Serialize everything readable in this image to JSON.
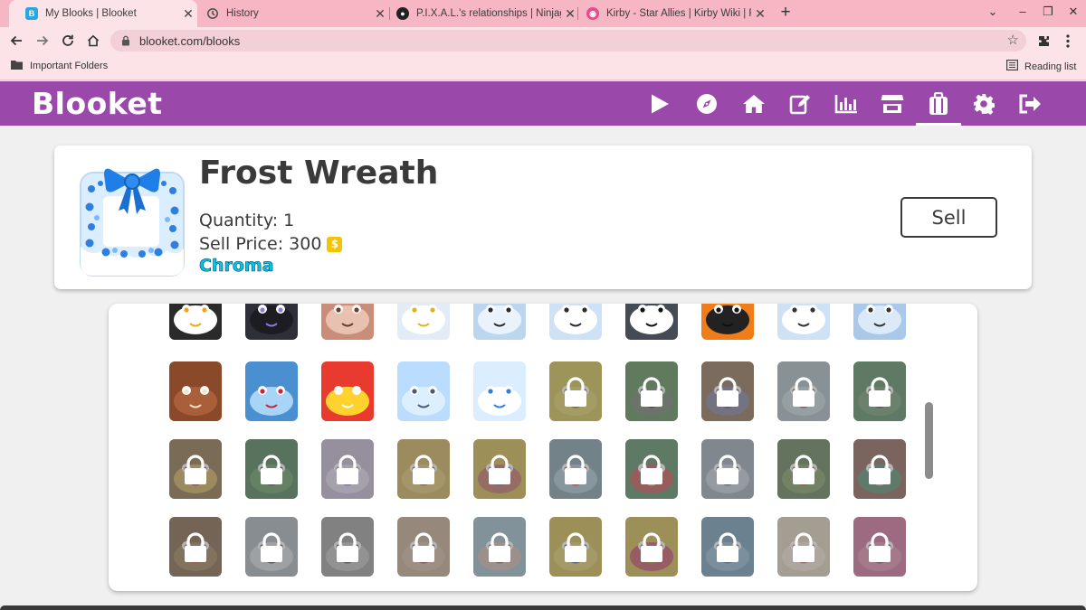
{
  "browser": {
    "tabs": [
      {
        "title": "My Blooks | Blooket",
        "favicon": "blooket-favicon",
        "active": true
      },
      {
        "title": "History",
        "favicon": "history-icon",
        "active": false
      },
      {
        "title": "P.I.X.A.L.'s relationships | Ninjago",
        "favicon": "fandom-favicon",
        "active": false
      },
      {
        "title": "Kirby - Star Allies | Kirby Wiki | Fa",
        "favicon": "kirby-favicon",
        "active": false
      }
    ],
    "url": "blooket.com/blooks",
    "bookmarks": {
      "folder": "Important Folders",
      "reading_list": "Reading list"
    }
  },
  "app": {
    "logo": "Blooket",
    "nav_icons": [
      "play-icon",
      "discover-icon",
      "home-icon",
      "create-icon",
      "stats-icon",
      "market-icon",
      "blooks-icon",
      "settings-icon",
      "logout-icon"
    ],
    "accent": "#9a49aa"
  },
  "selected_blook": {
    "name": "Frost Wreath",
    "quantity_label": "Quantity: 1",
    "sell_price_label": "Sell Price: 300",
    "coin_symbol": "$",
    "rarity": "Chroma",
    "rarity_color": "#00c6f2",
    "sell_button": "Sell"
  },
  "inventory": {
    "rows": [
      [
        {
          "blook": "toucan",
          "locked": false
        },
        {
          "blook": "panther",
          "locked": false
        },
        {
          "blook": "baboon",
          "locked": false
        },
        {
          "blook": "snowy-owl",
          "locked": false
        },
        {
          "blook": "polar-bear",
          "locked": false
        },
        {
          "blook": "arctic-fox",
          "locked": false
        },
        {
          "blook": "penguin",
          "locked": false
        },
        {
          "blook": "rockhopper",
          "locked": false
        },
        {
          "blook": "arctic-hare",
          "locked": false
        },
        {
          "blook": "seal",
          "locked": false
        }
      ],
      [
        {
          "blook": "walrus",
          "locked": false
        },
        {
          "blook": "shark",
          "locked": false
        },
        {
          "blook": "santa-claus",
          "locked": false
        },
        {
          "blook": "snow-globe",
          "locked": false
        },
        {
          "blook": "frost-wreath",
          "locked": false
        },
        {
          "blook": "yellow-cat",
          "locked": true
        },
        {
          "blook": "green-goblin",
          "locked": true
        },
        {
          "blook": "witch",
          "locked": true
        },
        {
          "blook": "jar",
          "locked": true
        },
        {
          "blook": "zombie",
          "locked": true
        }
      ],
      [
        {
          "blook": "gift-box",
          "locked": true
        },
        {
          "blook": "green-monster",
          "locked": true
        },
        {
          "blook": "unicorn",
          "locked": true
        },
        {
          "blook": "lion",
          "locked": true
        },
        {
          "blook": "yellow-flower",
          "locked": true
        },
        {
          "blook": "snow-globe-house",
          "locked": true
        },
        {
          "blook": "present",
          "locked": true
        },
        {
          "blook": "robot",
          "locked": true
        },
        {
          "blook": "wreath",
          "locked": true
        },
        {
          "blook": "brown-monster",
          "locked": true
        }
      ],
      [
        {
          "blook": "gingerbread",
          "locked": true
        },
        {
          "blook": "snowman",
          "locked": true
        },
        {
          "blook": "playing-card",
          "locked": true
        },
        {
          "blook": "cookie",
          "locked": true
        },
        {
          "blook": "jar-lid",
          "locked": true
        },
        {
          "blook": "chick",
          "locked": true
        },
        {
          "blook": "gift",
          "locked": true
        },
        {
          "blook": "teapot",
          "locked": true
        },
        {
          "blook": "bunny",
          "locked": true
        },
        {
          "blook": "pink-cat",
          "locked": true
        }
      ]
    ]
  }
}
